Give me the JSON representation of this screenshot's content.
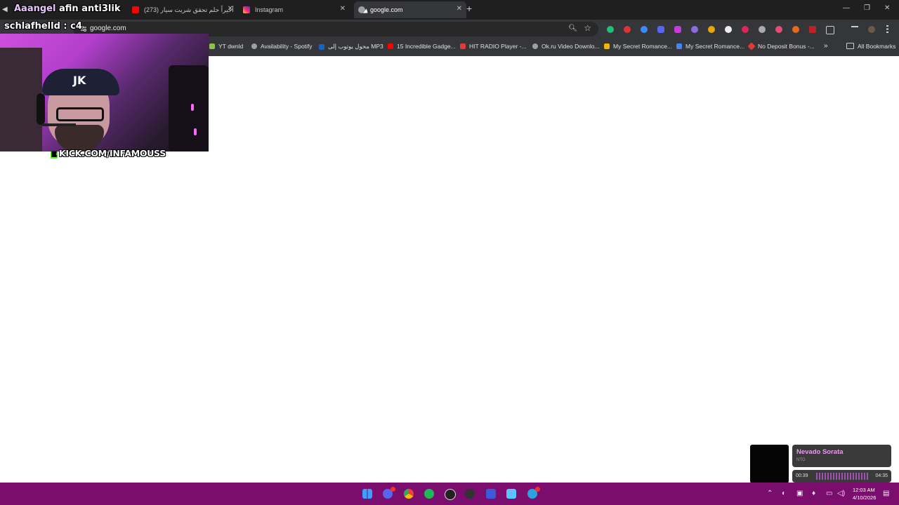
{
  "overlay": {
    "chat_line_1_prefix": "Aaangel",
    "chat_line_1_suffix": "afin anti3lik",
    "chat_line_2": "schlafhelld : c4",
    "kick_url": "KICK.COM/INFAMOUSS"
  },
  "tabs": [
    {
      "title": "أخيراً حلم تحقق شريت سيار (273)",
      "favicon": "youtube-icon",
      "color": "#ff0000"
    },
    {
      "title": "Instagram",
      "favicon": "instagram-icon",
      "color": "#e1306c"
    },
    {
      "title": "google.com",
      "favicon": "globe-icon",
      "color": "#9aa0a6"
    }
  ],
  "new_tab_label": "+",
  "address_bar": {
    "url": "google.com"
  },
  "bookmarks": [
    {
      "label": "YT  dwnld",
      "icon": "download-icon",
      "color": "#8bc34a"
    },
    {
      "label": "Availability - Spotify",
      "icon": "globe-icon",
      "color": "#9aa0a6"
    },
    {
      "label": "محول يوتوب إلى MP3",
      "icon": "bookmark-icon",
      "color": "#1565c0"
    },
    {
      "label": "15 Incredible Gadge...",
      "icon": "youtube-icon",
      "color": "#ff0000"
    },
    {
      "label": "HIT RADIO Player -...",
      "icon": "star-icon",
      "color": "#e53935"
    },
    {
      "label": "Ok.ru Video Downlo...",
      "icon": "globe-icon",
      "color": "#9aa0a6"
    },
    {
      "label": "My Secret Romance...",
      "icon": "folder-icon",
      "color": "#f4b400"
    },
    {
      "label": "My Secret Romance...",
      "icon": "bookmark-icon",
      "color": "#4285f4"
    },
    {
      "label": "No Deposit Bonus -...",
      "icon": "diamond-icon",
      "color": "#e53935"
    }
  ],
  "bookmarks_more": "»",
  "all_bookmarks_label": "All Bookmarks",
  "music": {
    "title": "Nevado Sorata",
    "artist": "NTO",
    "elapsed": "00:39",
    "total": "04:35",
    "progress": 0.14
  },
  "clock": {
    "time": "12:03 AM",
    "date": "4/10/2026"
  },
  "colors": {
    "taskbar": "#7a0d6e",
    "chrome_dark": "#35363a",
    "accent_pink": "#d04be6"
  }
}
